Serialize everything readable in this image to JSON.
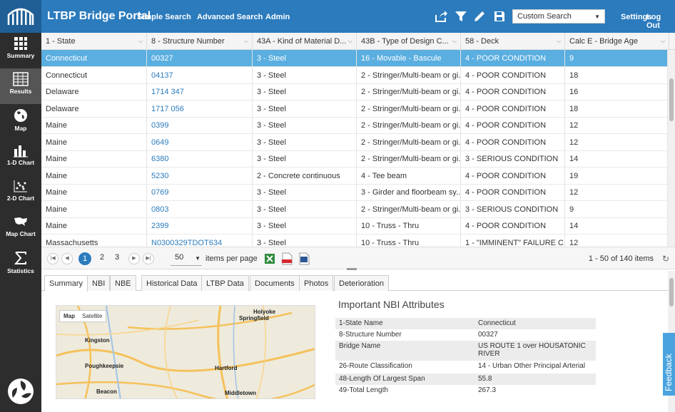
{
  "app": {
    "title": "LTBP Bridge Portal",
    "nav": [
      "Simple Search",
      "Advanced Search",
      "Admin"
    ],
    "custom_search": "Custom Search",
    "settings": "Settings",
    "logout": "Log Out"
  },
  "sidebar": {
    "items": [
      {
        "label": "Summary",
        "icon": "summary-grid-icon"
      },
      {
        "label": "Results",
        "icon": "results-table-icon"
      },
      {
        "label": "Map",
        "icon": "globe-icon"
      },
      {
        "label": "1-D Chart",
        "icon": "bar-chart-icon"
      },
      {
        "label": "2-D Chart",
        "icon": "scatter-chart-icon"
      },
      {
        "label": "Map Chart",
        "icon": "us-map-icon"
      },
      {
        "label": "Statistics",
        "icon": "sigma-icon"
      }
    ],
    "active": "Results"
  },
  "grid": {
    "columns": [
      "1 - State",
      "8 - Structure Number",
      "43A - Kind of Material D...",
      "43B - Type of Design C...",
      "58 - Deck",
      "Calc E - Bridge Age"
    ],
    "rows": [
      [
        "Connecticut",
        "00327",
        "3 - Steel",
        "16 - Movable - Bascule",
        "4 - POOR CONDITION",
        "9"
      ],
      [
        "Connecticut",
        "04137",
        "3 - Steel",
        "2 - Stringer/Multi-beam or gi...",
        "4 - POOR CONDITION",
        "18"
      ],
      [
        "Delaware",
        "1714 347",
        "3 - Steel",
        "2 - Stringer/Multi-beam or gi...",
        "4 - POOR CONDITION",
        "16"
      ],
      [
        "Delaware",
        "1717 056",
        "3 - Steel",
        "2 - Stringer/Multi-beam or gi...",
        "4 - POOR CONDITION",
        "18"
      ],
      [
        "Maine",
        "0399",
        "3 - Steel",
        "2 - Stringer/Multi-beam or gi...",
        "4 - POOR CONDITION",
        "12"
      ],
      [
        "Maine",
        "0649",
        "3 - Steel",
        "2 - Stringer/Multi-beam or gi...",
        "4 - POOR CONDITION",
        "12"
      ],
      [
        "Maine",
        "6380",
        "3 - Steel",
        "2 - Stringer/Multi-beam or gi...",
        "3 - SERIOUS CONDITION",
        "14"
      ],
      [
        "Maine",
        "5230",
        "2 - Concrete continuous",
        "4 - Tee beam",
        "4 - POOR CONDITION",
        "19"
      ],
      [
        "Maine",
        "0769",
        "3 - Steel",
        "3 - Girder and floorbeam sy...",
        "4 - POOR CONDITION",
        "12"
      ],
      [
        "Maine",
        "0803",
        "3 - Steel",
        "2 - Stringer/Multi-beam or gi...",
        "3 - SERIOUS CONDITION",
        "9"
      ],
      [
        "Maine",
        "2399",
        "3 - Steel",
        "10 - Truss - Thru",
        "4 - POOR CONDITION",
        "14"
      ],
      [
        "Massachusetts",
        "N0300329TDOT634",
        "3 - Steel",
        "10 - Truss - Thru",
        "1 - \"IMMINENT\" FAILURE C...",
        "12"
      ]
    ],
    "selected_row": 0
  },
  "pager": {
    "pages": [
      "1",
      "2",
      "3"
    ],
    "current": "1",
    "per_page": "50",
    "per_page_label": "items per page",
    "count": "1 - 50 of 140 items"
  },
  "tabs": [
    "Summary",
    "NBI",
    "NBE",
    "Historical Data",
    "LTBP Data",
    "Documents",
    "Photos",
    "Deterioration"
  ],
  "map": {
    "toggle": [
      "Map",
      "Satellite"
    ],
    "towns": [
      "Holyoke",
      "Springfield",
      "Kingston",
      "Hartford",
      "Poughkeepsie",
      "Beacon",
      "Middletown"
    ]
  },
  "nbi": {
    "title": "Important NBI Attributes",
    "rows": [
      {
        "key": "1-State Name",
        "value": "Connecticut"
      },
      {
        "key": "8-Structure Number",
        "value": "00327"
      },
      {
        "key": "Bridge Name",
        "value": "US ROUTE 1 over HOUSATONIC RIVER"
      },
      {
        "key": "26-Route Classification",
        "value": "14 - Urban Other Principal Arterial"
      },
      {
        "key": "48-Length Of Largest Span",
        "value": "55.8"
      },
      {
        "key": "49-Total Length",
        "value": "267.3"
      }
    ]
  },
  "feedback": "Feedback",
  "colors": {
    "topbar": "#2b7bbd",
    "sidebar": "#2d2d2d",
    "selected_row": "#5aaee0",
    "link": "#2b7bbd"
  }
}
